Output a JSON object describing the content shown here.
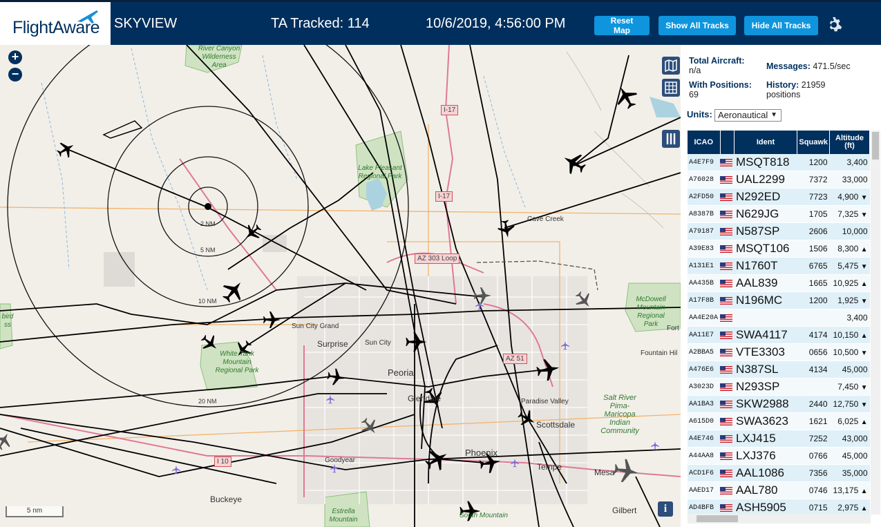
{
  "header": {
    "logo_text": "FlightAware",
    "app_name": "SKYVIEW",
    "tracked": "TA Tracked: 114",
    "datetime": "10/6/2019, 4:56:00 PM",
    "buttons": {
      "reset": "Reset Map",
      "show": "Show All Tracks",
      "hide": "Hide All Tracks"
    }
  },
  "map": {
    "zoom_in": "+",
    "zoom_out": "−",
    "scale": "5 nm",
    "info": "i",
    "rings": [
      "2 NM",
      "5 NM",
      "10 NM",
      "20 NM"
    ],
    "labels": {
      "surprise": "Surprise",
      "sun_city": "Sun City",
      "sun_city_grand": "Sun City Grand",
      "peoria": "Peoria",
      "glendale": "Glendale",
      "phoenix": "Phoenix",
      "scottsdale": "Scottsdale",
      "paradise_valley": "Paradise Valley",
      "tempe": "Tempe",
      "mesa": "Mesa",
      "gilbert": "Gilbert",
      "goodyear": "Goodyear",
      "buckeye": "Buckeye",
      "cave_creek": "Cave Creek",
      "fountain_hills": "Fountain Hil",
      "fort": "Fort"
    },
    "parks": {
      "lake_pleasant": "Lake Pleasant Regional Park",
      "white_tank": "White Tank Mountain Regional Park",
      "mcdowell": "McDowell Mountain Regional Park",
      "salt_river": "Salt River Pima-Maricopa Indian Community",
      "estrella": "Estrella Mountain",
      "river_canyon": "River Canyon Wilderness Area",
      "hassayampa": "bird ss",
      "south_mountain": "South Mountain"
    },
    "highways": {
      "i17a": "I-17",
      "i17b": "I-17",
      "az303": "AZ 303 Loop",
      "az51": "AZ 51",
      "i10": "I 10"
    }
  },
  "stats": {
    "total_label": "Total Aircraft:",
    "total_value": "n/a",
    "messages_label": "Messages:",
    "messages_value": "471.5/sec",
    "positions_label": "With Positions:",
    "positions_value": "69",
    "history_label": "History:",
    "history_value": "21959 positions"
  },
  "units": {
    "label": "Units:",
    "selected": "Aeronautical"
  },
  "table": {
    "headers": [
      "ICAO",
      "",
      "Ident",
      "Squawk",
      "Altitude (ft)"
    ],
    "rows": [
      {
        "icao": "A4E7F9",
        "ident": "MSQT818",
        "squawk": "1200",
        "alt": "3,400",
        "trend": ""
      },
      {
        "icao": "A76028",
        "ident": "UAL2299",
        "squawk": "7372",
        "alt": "33,000",
        "trend": ""
      },
      {
        "icao": "A2FD50",
        "ident": "N292ED",
        "squawk": "7723",
        "alt": "4,900",
        "trend": "▼"
      },
      {
        "icao": "A8387B",
        "ident": "N629JG",
        "squawk": "1705",
        "alt": "7,325",
        "trend": "▼"
      },
      {
        "icao": "A79187",
        "ident": "N587SP",
        "squawk": "2606",
        "alt": "10,000",
        "trend": ""
      },
      {
        "icao": "A39E83",
        "ident": "MSQT106",
        "squawk": "1506",
        "alt": "8,300",
        "trend": "▲"
      },
      {
        "icao": "A131E1",
        "ident": "N1760T",
        "squawk": "6765",
        "alt": "5,475",
        "trend": "▼"
      },
      {
        "icao": "AA435B",
        "ident": "AAL839",
        "squawk": "1665",
        "alt": "10,925",
        "trend": "▲"
      },
      {
        "icao": "A17F8B",
        "ident": "N196MC",
        "squawk": "1200",
        "alt": "1,925",
        "trend": "▼"
      },
      {
        "icao": "AA4E20A",
        "ident": "",
        "squawk": "",
        "alt": "3,400",
        "trend": ""
      },
      {
        "icao": "AA11E7",
        "ident": "SWA4117",
        "squawk": "4174",
        "alt": "10,150",
        "trend": "▲"
      },
      {
        "icao": "A2BBA5",
        "ident": "VTE3303",
        "squawk": "0656",
        "alt": "10,500",
        "trend": "▼"
      },
      {
        "icao": "A476E6",
        "ident": "N387SL",
        "squawk": "4134",
        "alt": "45,000",
        "trend": ""
      },
      {
        "icao": "A3023D",
        "ident": "N293SP",
        "squawk": "",
        "alt": "7,450",
        "trend": "▼"
      },
      {
        "icao": "AA1BA3",
        "ident": "SKW2988",
        "squawk": "2440",
        "alt": "12,750",
        "trend": "▼"
      },
      {
        "icao": "A615D0",
        "ident": "SWA3623",
        "squawk": "1621",
        "alt": "6,025",
        "trend": "▲"
      },
      {
        "icao": "A4E746",
        "ident": "LXJ415",
        "squawk": "7252",
        "alt": "43,000",
        "trend": ""
      },
      {
        "icao": "A44AA8",
        "ident": "LXJ376",
        "squawk": "0766",
        "alt": "45,000",
        "trend": ""
      },
      {
        "icao": "ACD1F6",
        "ident": "AAL1086",
        "squawk": "7356",
        "alt": "35,000",
        "trend": ""
      },
      {
        "icao": "AAED17",
        "ident": "AAL780",
        "squawk": "0746",
        "alt": "13,175",
        "trend": "▲"
      },
      {
        "icao": "AD4BFB",
        "ident": "ASH5905",
        "squawk": "0715",
        "alt": "2,975",
        "trend": "▲"
      }
    ]
  },
  "colors": {
    "header_bg": "#002f5d",
    "button": "#0f95dd",
    "row_odd": "#dff0f8",
    "table_header": "#00305e"
  }
}
